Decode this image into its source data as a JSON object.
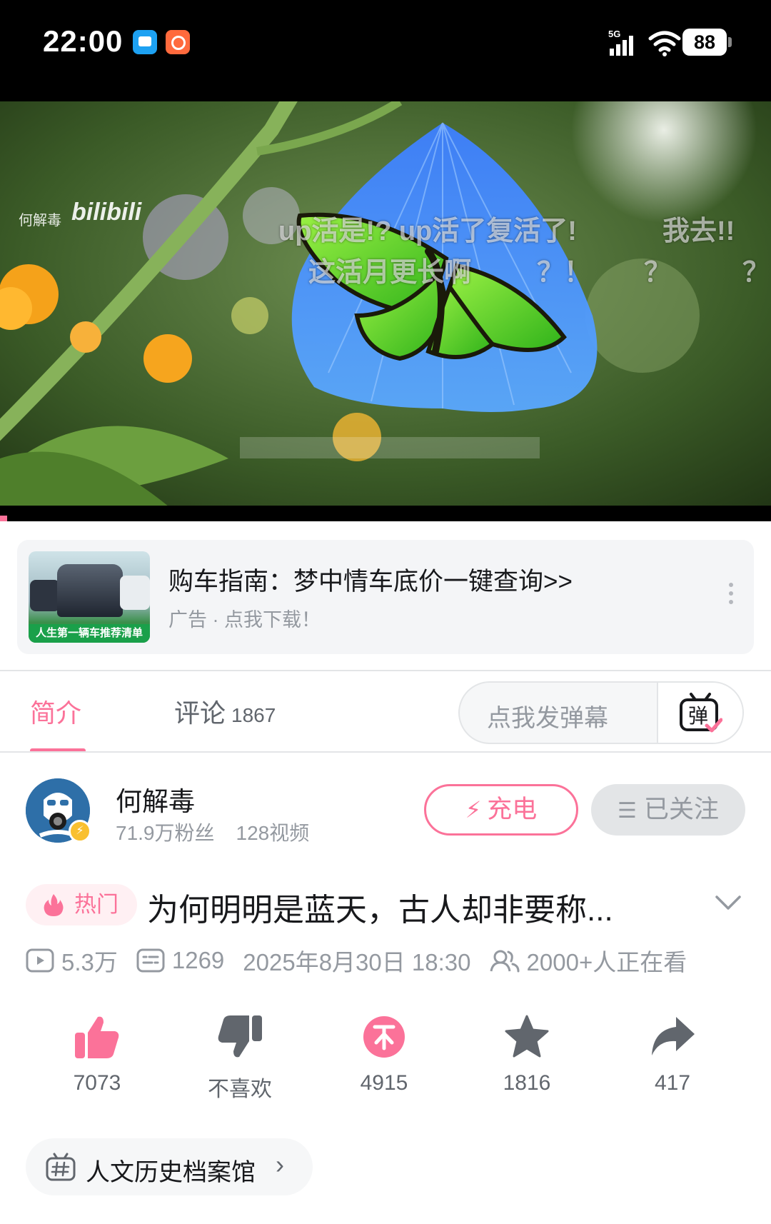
{
  "status_bar": {
    "time": "22:00",
    "network": "5G",
    "battery": "88"
  },
  "video": {
    "watermark_author": "何解毒",
    "watermark_logo": "bilibili",
    "danmaku": [
      "up活是!? up活了复活了!",
      "我去!!",
      "这活月更长啊",
      "？！",
      "？",
      "？"
    ]
  },
  "ad": {
    "thumb_caption": "人生第一辆车推荐清单",
    "title": "购车指南：梦中情车底价一键查询>>",
    "subtitle": "广告 · 点我下载！"
  },
  "tabs": {
    "intro_label": "简介",
    "comments_label": "评论",
    "comments_count": "1867",
    "danmaku_placeholder": "点我发弹幕",
    "danmaku_button_glyph": "弹"
  },
  "uploader": {
    "name": "何解毒",
    "fans": "71.9万粉丝",
    "videos": "128视频",
    "charge_label": "充电",
    "follow_label": "已关注"
  },
  "title_section": {
    "hot_badge": "热门",
    "title": "为何明明是蓝天，古人却非要称...",
    "views": "5.3万",
    "danmaku_count": "1269",
    "publish_time": "2025年8月30日 18:30",
    "watching": "2000+人正在看"
  },
  "actions": {
    "like_count": "7073",
    "dislike_label": "不喜欢",
    "coin_count": "4915",
    "favorite_count": "1816",
    "share_count": "417"
  },
  "tag": {
    "label": "人文历史档案馆"
  },
  "colors": {
    "accent": "#fb7299",
    "text_primary": "#18191c",
    "text_secondary": "#9499a0",
    "icon_gray": "#61666d",
    "panel_bg": "#f4f5f7"
  }
}
